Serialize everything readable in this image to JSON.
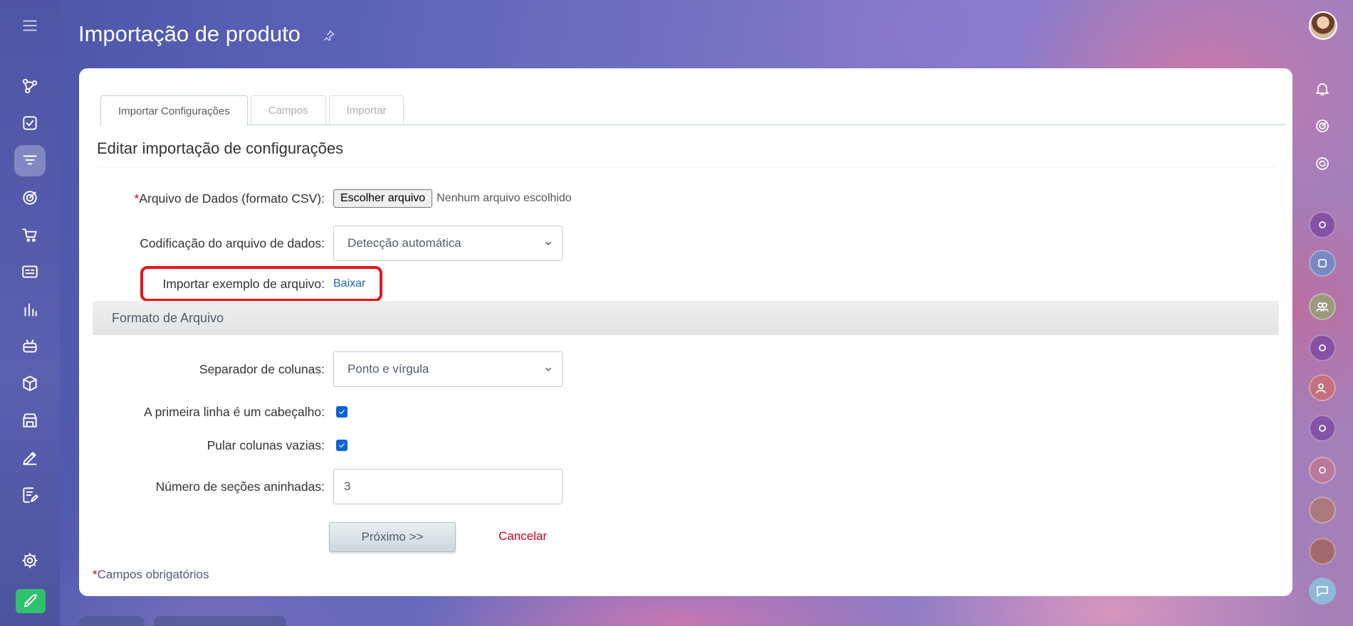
{
  "page": {
    "title": "Importação de produto"
  },
  "tabs": [
    {
      "label": "Importar Configurações",
      "active": true
    },
    {
      "label": "Campos",
      "active": false
    },
    {
      "label": "Importar",
      "active": false
    }
  ],
  "section": {
    "title": "Editar importação de configurações"
  },
  "form": {
    "data_file": {
      "required_mark": "*",
      "label": "Arquivo de Dados (formato CSV):",
      "button": "Escolher arquivo",
      "status": "Nenhum arquivo escolhido"
    },
    "encoding": {
      "label": "Codificação do arquivo de dados:",
      "value": "Detecção automática"
    },
    "sample": {
      "label": "Importar exemplo de arquivo:",
      "link": "Baixar"
    }
  },
  "file_format": {
    "title": "Formato de Arquivo",
    "separator": {
      "label": "Separador de colunas:",
      "value": "Ponto e vírgula"
    },
    "first_line_header": {
      "label": "A primeira linha é um cabeçalho:",
      "checked": true
    },
    "skip_empty": {
      "label": "Pular colunas vazias:",
      "checked": true
    },
    "nested_sections": {
      "label": "Número de seções aninhadas:",
      "value": "3"
    }
  },
  "actions": {
    "next": "Próximo >>",
    "cancel": "Cancelar"
  },
  "footer": {
    "required_mark": "*",
    "note": "Campos obrigatórios"
  },
  "colors": {
    "accent_link": "#2067b0",
    "required": "#d0021b",
    "checkbox": "#0b62d4",
    "highlight": "#e8141b",
    "rocket": "#2fc26d"
  }
}
